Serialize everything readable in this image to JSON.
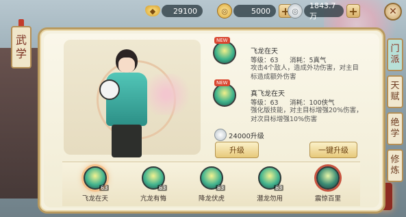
{
  "title_tag": "武\n学",
  "currency": {
    "gold": "29100",
    "yuanbao": "5000",
    "silver": "1843.7万",
    "plus": "+"
  },
  "close": "✕",
  "tabs": [
    {
      "label": "门\n派",
      "active": true
    },
    {
      "label": "天\n赋",
      "active": false
    },
    {
      "label": "绝\n学",
      "active": false
    },
    {
      "label": "修\n炼",
      "active": false
    }
  ],
  "skill_current": {
    "new_tag": "NEW",
    "name": "飞龙在天",
    "level": "等级：63",
    "cost": "消耗：5真气",
    "desc": "攻击4个敌人，造成外功伤害，对主目标造成额外伤害"
  },
  "skill_next": {
    "new_tag": "NEW",
    "name": "真飞龙在天",
    "level": "等级：63",
    "cost": "消耗：100侠气",
    "desc": "强化版技能，对主目标增强20%伤害，对次目标增强10%伤害"
  },
  "upgrade_cost": "24000升级",
  "buttons": {
    "upgrade": "升级",
    "upgrade_all": "一键升级"
  },
  "skill_slots": [
    {
      "name": "飞龙在天",
      "level": "63"
    },
    {
      "name": "亢龙有悔",
      "level": "63"
    },
    {
      "name": "降龙伏虎",
      "level": "63"
    },
    {
      "name": "潜龙勿用",
      "level": "63"
    },
    {
      "name": "震惊百里",
      "level": ""
    }
  ]
}
